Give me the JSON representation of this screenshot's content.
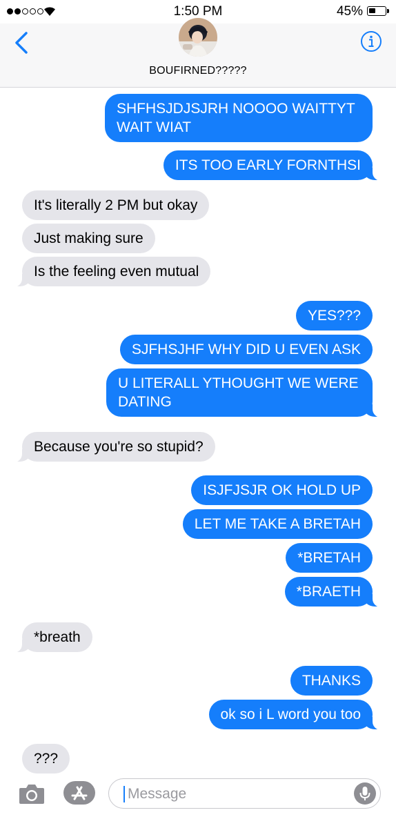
{
  "status_bar": {
    "time": "1:50 PM",
    "battery_percent_text": "45%",
    "battery_level": 0.45,
    "signal_bars_filled": 2,
    "signal_bars_total": 5
  },
  "header": {
    "contact_name": "BOUFIRNED?????",
    "back_icon": "chevron-left-icon",
    "info_icon": "info-icon"
  },
  "messages": [
    {
      "text": "SHFHSJDJSJRH NOOOO WAITTYT\nWAIT WIAT",
      "from": "me"
    },
    {
      "text": "ITS TOO EARLY FORNTHSI",
      "from": "me"
    },
    {
      "text": "It's literally 2 PM but okay",
      "from": "them"
    },
    {
      "text": "Just making sure",
      "from": "them"
    },
    {
      "text": "Is the feeling even mutual",
      "from": "them"
    },
    {
      "text": "YES???",
      "from": "me"
    },
    {
      "text": "SJFHSJHF WHY DID U EVEN ASK",
      "from": "me"
    },
    {
      "text": "U LITERALL YTHOUGHT WE WERE\nDATING",
      "from": "me"
    },
    {
      "text": "Because you're so stupid?",
      "from": "them"
    },
    {
      "text": "ISJFJSJR OK HOLD UP",
      "from": "me"
    },
    {
      "text": "LET ME TAKE A BRETAH",
      "from": "me"
    },
    {
      "text": "*BRETAH",
      "from": "me"
    },
    {
      "text": "*BRAETH",
      "from": "me"
    },
    {
      "text": "*breath",
      "from": "them"
    },
    {
      "text": "THANKS",
      "from": "me"
    },
    {
      "text": "ok so i L word you too",
      "from": "me"
    },
    {
      "text": "???",
      "from": "them"
    }
  ],
  "input_bar": {
    "placeholder": "Message",
    "value": "",
    "camera_icon": "camera-icon",
    "apps_icon": "app-store-icon",
    "mic_icon": "microphone-icon"
  },
  "colors": {
    "sent_bubble": "#157efb",
    "received_bubble": "#e5e5ea",
    "accent": "#157efb"
  }
}
